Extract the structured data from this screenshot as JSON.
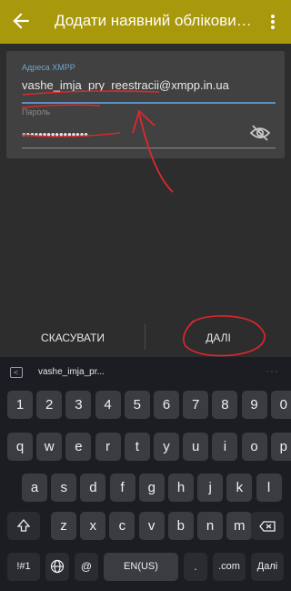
{
  "appbar": {
    "title": "Додати наявний обліковий запис",
    "back_icon": "arrow-left-icon",
    "menu_icon": "more-vert-icon"
  },
  "form": {
    "xmpp_label": "Адреса XMPP",
    "xmpp_value": "vashe_imja_pry_reestracii@xmpp.in.ua",
    "password_label": "Пароль",
    "password_value": "••••••••••••••••",
    "eye_icon": "visibility-off-icon"
  },
  "actions": {
    "cancel_label": "СКАСУВАТИ",
    "next_label": "ДАЛІ"
  },
  "keyboard": {
    "suggestion": "vashe_imja_pr...",
    "row_digits": [
      "1",
      "2",
      "3",
      "4",
      "5",
      "6",
      "7",
      "8",
      "9",
      "0"
    ],
    "row_q": [
      "q",
      "w",
      "e",
      "r",
      "t",
      "y",
      "u",
      "i",
      "o",
      "p"
    ],
    "row_a": [
      "a",
      "s",
      "d",
      "f",
      "g",
      "h",
      "j",
      "k",
      "l"
    ],
    "row_z": [
      "z",
      "x",
      "c",
      "v",
      "b",
      "n",
      "m"
    ],
    "sym_label": "!#1",
    "at_label": "@",
    "space_label": "EN(US)",
    "dot_label": ".",
    "com_label": ".com",
    "enter_label": "Далі"
  },
  "colors": {
    "appbar": "#a8980b",
    "accent": "#5e8fc2",
    "annotation": "#e0272c"
  }
}
